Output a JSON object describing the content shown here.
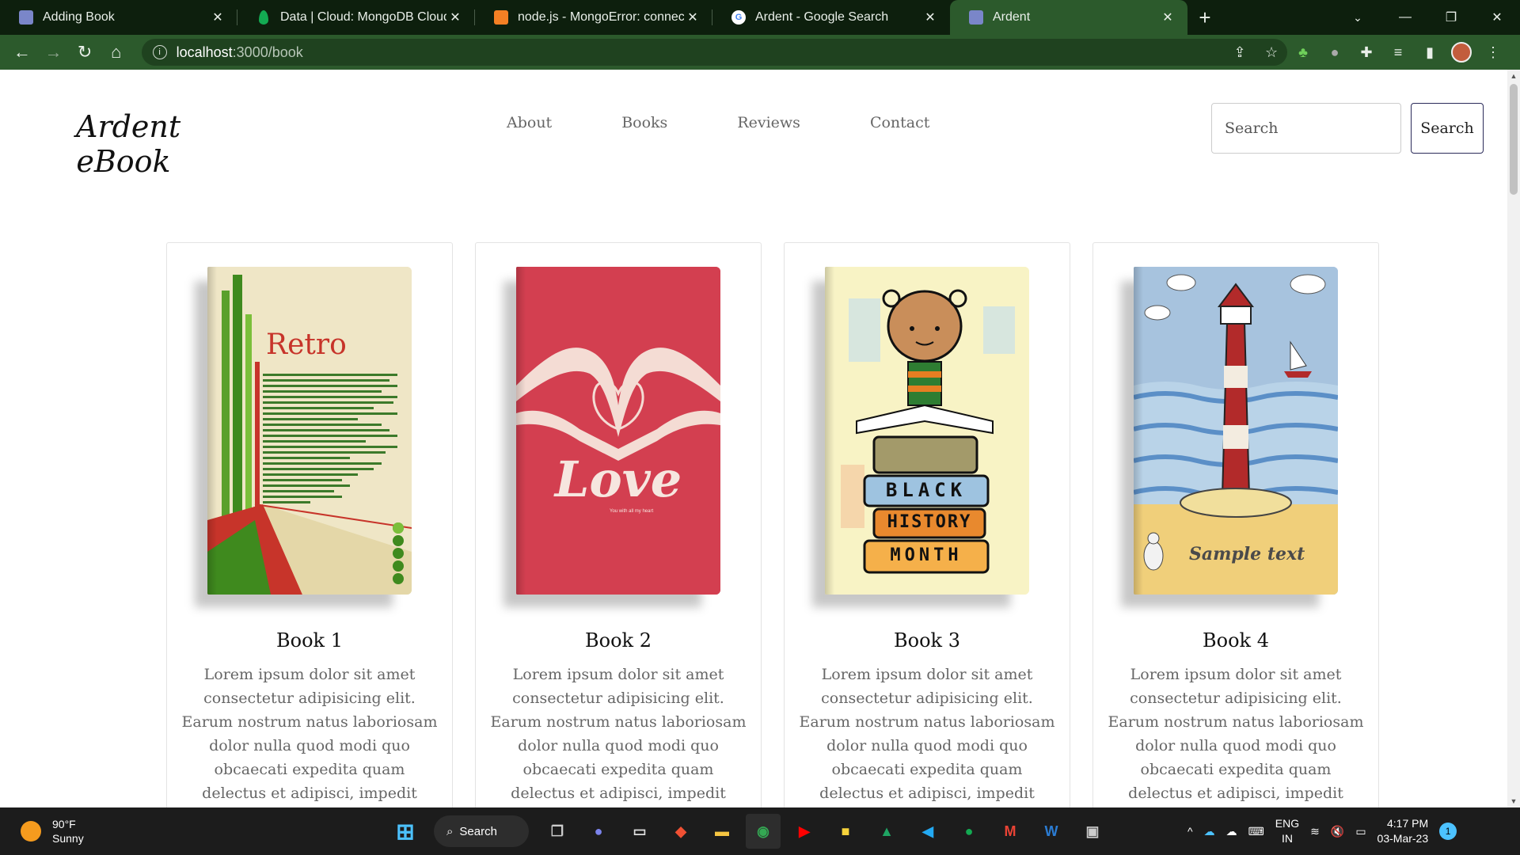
{
  "browser": {
    "tabs": [
      {
        "title": "Adding Book",
        "favicon_color": "#7a86c9",
        "active": false
      },
      {
        "title": "Data | Cloud: MongoDB Cloud",
        "favicon_color": "#13aa52",
        "active": false
      },
      {
        "title": "node.js - MongoError: connect E",
        "favicon_color": "#f48024",
        "active": false
      },
      {
        "title": "Ardent - Google Search",
        "favicon_color": "#4285f4",
        "active": false
      },
      {
        "title": "Ardent",
        "favicon_color": "#7a86c9",
        "active": true
      }
    ],
    "url_host": "localhost",
    "url_path": ":3000/book",
    "theme_color": "#2c5a2c"
  },
  "site": {
    "logo_line1": "Ardent",
    "logo_line2": "eBook",
    "nav": [
      "About",
      "Books",
      "Reviews",
      "Contact"
    ],
    "search_placeholder": "Search",
    "search_button": "Search"
  },
  "books": [
    {
      "title": "Book 1",
      "cover": "retro",
      "cover_text": "Retro",
      "description": "Lorem ipsum dolor sit amet consectetur adipisicing elit. Earum nostrum natus laboriosam dolor nulla quod modi quo obcaecati expedita quam delectus et adipisci, impedit quisquam beatae dolore!"
    },
    {
      "title": "Book 2",
      "cover": "love",
      "cover_text": "Love",
      "cover_subtext": "You with all my heart",
      "description": "Lorem ipsum dolor sit amet consectetur adipisicing elit. Earum nostrum natus laboriosam dolor nulla quod modi quo obcaecati expedita quam delectus et adipisci, impedit quisquam beatae dolore!"
    },
    {
      "title": "Book 3",
      "cover": "black-history",
      "cover_text_1": "BLACK",
      "cover_text_2": "HISTORY",
      "cover_text_3": "MONTH",
      "description": "Lorem ipsum dolor sit amet consectetur adipisicing elit. Earum nostrum natus laboriosam dolor nulla quod modi quo obcaecati expedita quam delectus et adipisci, impedit quisquam beatae dolore!"
    },
    {
      "title": "Book 4",
      "cover": "lighthouse",
      "cover_text": "Sample text",
      "description": "Lorem ipsum dolor sit amet consectetur adipisicing elit. Earum nostrum natus laboriosam dolor nulla quod modi quo obcaecati expedita quam delectus et adipisci, impedit quisquam beatae dolore!"
    }
  ],
  "taskbar": {
    "weather_temp": "90°F",
    "weather_desc": "Sunny",
    "search_label": "Search",
    "lang_1": "ENG",
    "lang_2": "IN",
    "time": "4:17 PM",
    "date": "03-Mar-23",
    "notification_count": "1"
  }
}
